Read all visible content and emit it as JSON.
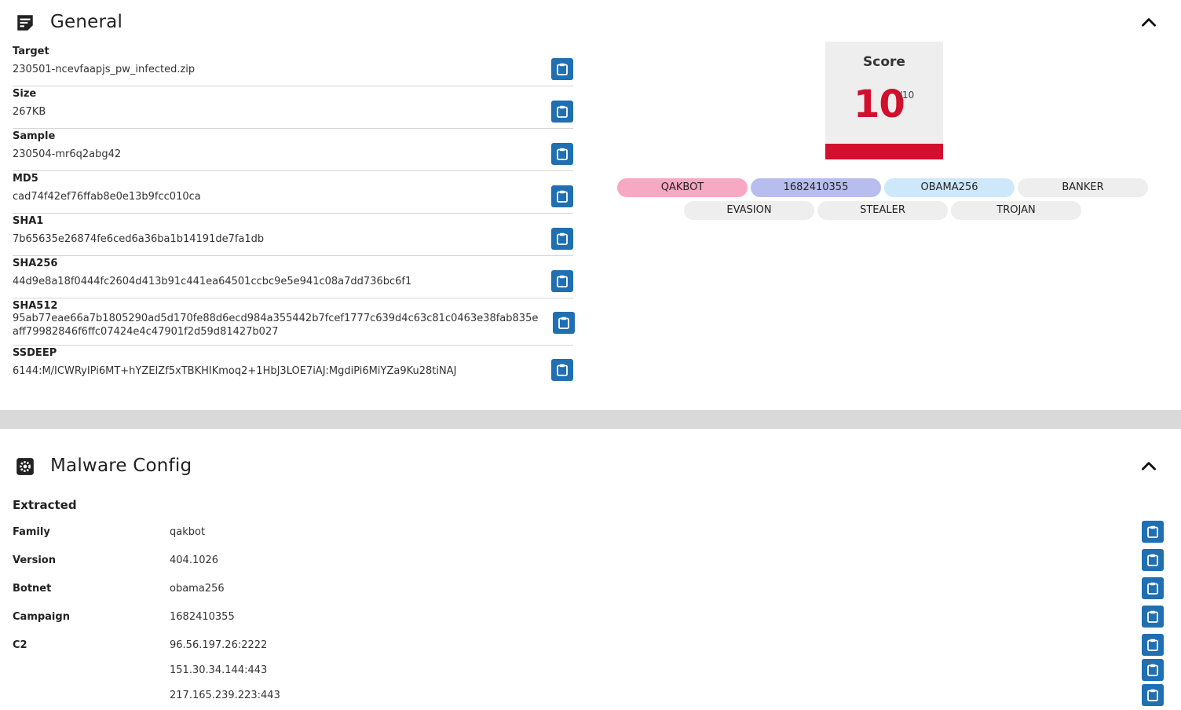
{
  "general": {
    "title": "General",
    "fields": [
      {
        "label": "Target",
        "value": "230501-ncevfaapjs_pw_infected.zip"
      },
      {
        "label": "Size",
        "value": "267KB"
      },
      {
        "label": "Sample",
        "value": "230504-mr6q2abg42"
      },
      {
        "label": "MD5",
        "value": "cad74f42ef76ffab8e0e13b9fcc010ca"
      },
      {
        "label": "SHA1",
        "value": "7b65635e26874fe6ced6a36ba1b14191de7fa1db"
      },
      {
        "label": "SHA256",
        "value": "44d9e8a18f0444fc2604d413b91c441ea64501ccbc9e5e941c08a7dd736bc6f1"
      },
      {
        "label": "SHA512",
        "value": "95ab77eae66a7b1805290ad5d170fe88d6ecd984a355442b7fcef1777c639d4c63c81c0463e38fab835eaff79982846f6ffc07424e4c47901f2d59d81427b027"
      },
      {
        "label": "SSDEEP",
        "value": "6144:M/ICWRyIPi6MT+hYZEIZf5xTBKHIKmoq2+1HbJ3LOE7iAJ:MgdiPi6MiYZa9Ku28tiNAJ"
      }
    ],
    "score": {
      "label": "Score",
      "value": "10",
      "max": "/10",
      "level": 1.0
    },
    "tags": [
      {
        "text": "QAKBOT",
        "color": "#f7a8c3"
      },
      {
        "text": "1682410355",
        "color": "#b7bdee"
      },
      {
        "text": "OBAMA256",
        "color": "#cde8fb"
      },
      {
        "text": "BANKER",
        "color": "#eeeeee"
      },
      {
        "text": "EVASION",
        "color": "#eeeeee"
      },
      {
        "text": "STEALER",
        "color": "#eeeeee"
      },
      {
        "text": "TROJAN",
        "color": "#eeeeee"
      }
    ]
  },
  "malware": {
    "title": "Malware Config",
    "extracted_title": "Extracted",
    "rows": [
      {
        "key": "Family",
        "value": "qakbot"
      },
      {
        "key": "Version",
        "value": "404.1026"
      },
      {
        "key": "Botnet",
        "value": "obama256"
      },
      {
        "key": "Campaign",
        "value": "1682410355"
      },
      {
        "key": "C2",
        "value": "96.56.197.26:2222"
      },
      {
        "key": "",
        "value": "151.30.34.144:443"
      },
      {
        "key": "",
        "value": "217.165.239.223:443"
      }
    ]
  },
  "colors": {
    "accent": "#1f6fb2",
    "score_red": "#d20f2d",
    "separator": "#d9d9d9"
  },
  "icons": {
    "general": "note-icon",
    "malware": "gear-icon",
    "collapse": "chevron-up-icon",
    "copy": "clipboard-icon"
  }
}
